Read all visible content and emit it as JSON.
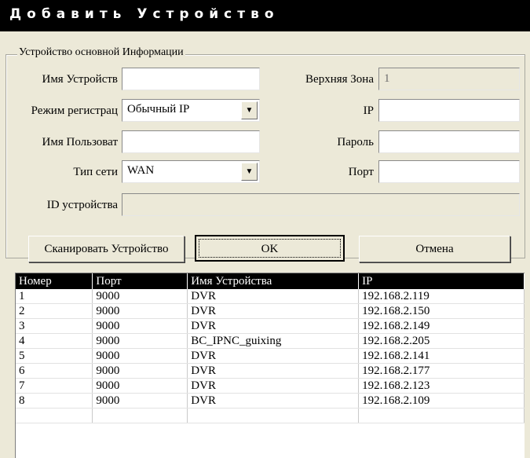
{
  "window": {
    "title": "Добавить Устройство"
  },
  "group": {
    "legend": "Устройство основной Информации"
  },
  "form": {
    "device_name_label": "Имя Устройств",
    "device_name_value": "",
    "upper_zone_label": "Верхняя Зона",
    "upper_zone_value": "1",
    "reg_mode_label": "Режим регистрац",
    "reg_mode_value": "Обычный IP",
    "ip_label": "IP",
    "ip_value": "",
    "user_label": "Имя Пользоват",
    "user_value": "",
    "password_label": "Пароль",
    "password_value": "",
    "net_type_label": "Тип сети",
    "net_type_value": "WAN",
    "port_label": "Порт",
    "port_value": "",
    "device_id_label": "ID устройства",
    "device_id_value": ""
  },
  "buttons": {
    "scan": "Сканировать Устройство",
    "ok": "OK",
    "cancel": "Отмена"
  },
  "table": {
    "headers": [
      "Номер",
      "Порт",
      "Имя Устройства",
      "IP"
    ],
    "rows": [
      [
        "1",
        "9000",
        "DVR",
        "192.168.2.119"
      ],
      [
        "2",
        "9000",
        "DVR",
        "192.168.2.150"
      ],
      [
        "3",
        "9000",
        "DVR",
        "192.168.2.149"
      ],
      [
        "4",
        "9000",
        "BC_IPNC_guixing",
        "192.168.2.205"
      ],
      [
        "5",
        "9000",
        "DVR",
        "192.168.2.141"
      ],
      [
        "6",
        "9000",
        "DVR",
        "192.168.2.177"
      ],
      [
        "7",
        "9000",
        "DVR",
        "192.168.2.123"
      ],
      [
        "8",
        "9000",
        "DVR",
        "192.168.2.109"
      ]
    ]
  },
  "icons": {
    "dropdown": "chevron-down-icon"
  }
}
